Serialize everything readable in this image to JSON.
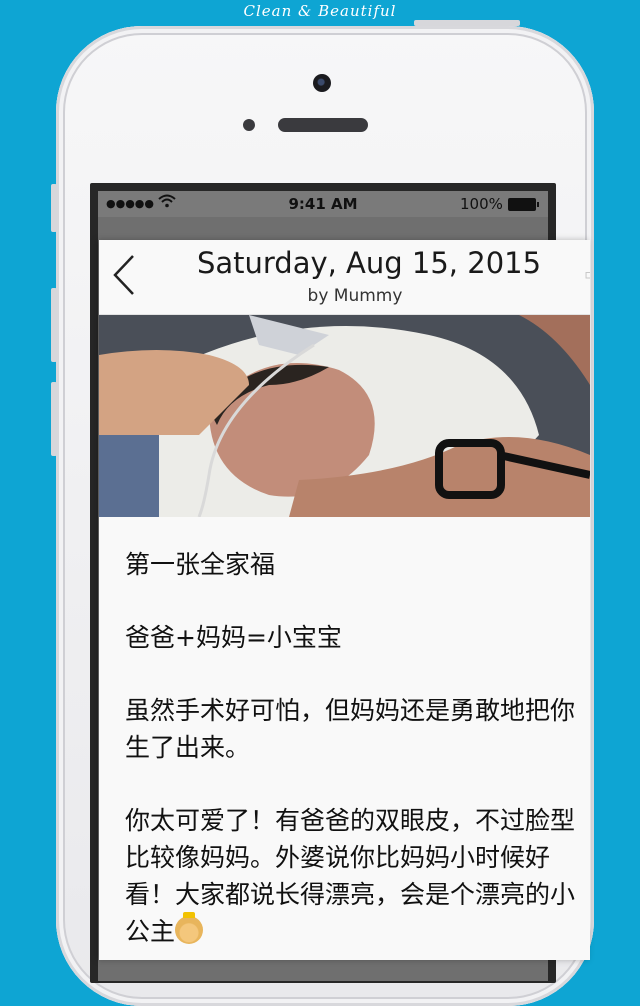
{
  "tagline": "Clean & Beautiful",
  "status_bar": {
    "signal": "●●●●●",
    "wifi": "wifi-icon",
    "time": "9:41 AM",
    "battery_label": "100%"
  },
  "entry": {
    "date_title": "Saturday, Aug 15, 2015",
    "author": "by Mummy",
    "photo_description": "newborn-family-photo",
    "paragraphs": [
      [
        "第一张全家福"
      ],
      [
        "爸爸+妈妈=小宝宝"
      ],
      [
        "虽然手术好可怕，但妈妈还是勇敢地把你",
        "生了出来。"
      ],
      [
        "你太可爱了！有爸爸的双眼皮，不过脸型",
        "比较像妈妈。外婆说你比妈妈小时候好",
        "看！大家都说长得漂亮，会是个漂亮的小",
        "公主"
      ]
    ],
    "emoji": "princess-emoji"
  },
  "colors": {
    "background": "#0ea5d3",
    "phone_body": "#f2f2f4",
    "card": "#f9f9f9"
  }
}
